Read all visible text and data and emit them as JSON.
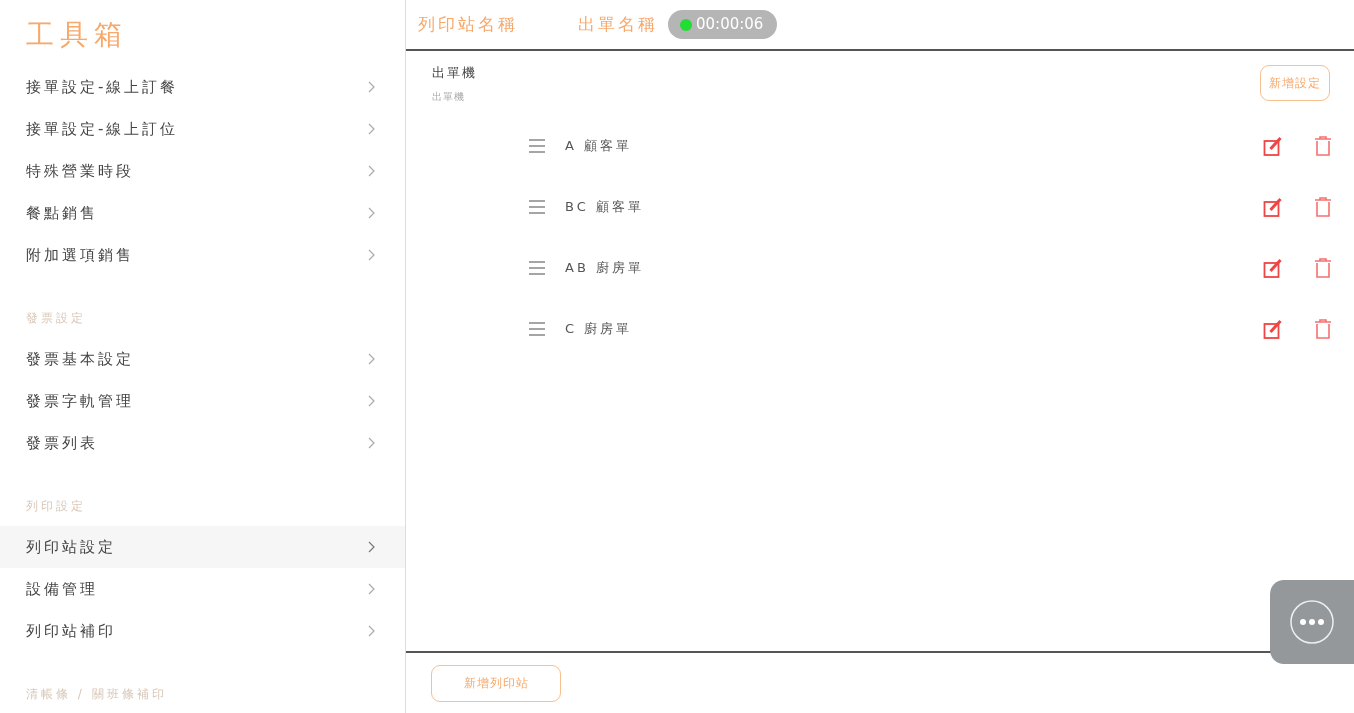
{
  "sidebar": {
    "title": "工具箱",
    "sections": [
      {
        "items": [
          {
            "label": "接單設定-線上訂餐",
            "selected": false
          },
          {
            "label": "接單設定-線上訂位",
            "selected": false
          },
          {
            "label": "特殊營業時段",
            "selected": false
          },
          {
            "label": "餐點銷售",
            "selected": false
          },
          {
            "label": "附加選項銷售",
            "selected": false
          }
        ]
      },
      {
        "heading": "發票設定",
        "items": [
          {
            "label": "發票基本設定",
            "selected": false
          },
          {
            "label": "發票字軌管理",
            "selected": false
          },
          {
            "label": "發票列表",
            "selected": false
          }
        ]
      },
      {
        "heading": "列印設定",
        "items": [
          {
            "label": "列印站設定",
            "selected": true
          },
          {
            "label": "設備管理",
            "selected": false
          },
          {
            "label": "列印站補印",
            "selected": false
          }
        ]
      },
      {
        "heading": "清帳條 / 關班條補印"
      }
    ]
  },
  "header": {
    "columns": [
      "列印站名稱",
      "出單名稱"
    ],
    "recording_time": "00:00:06"
  },
  "printer": {
    "name": "出單機",
    "subtitle": "出單機",
    "add_button": "新增設定"
  },
  "slips": [
    {
      "label": "A 顧客單"
    },
    {
      "label": "BC 顧客單"
    },
    {
      "label": "AB 廚房單"
    },
    {
      "label": "C 廚房單"
    }
  ],
  "add_station_button": "新增列印站"
}
